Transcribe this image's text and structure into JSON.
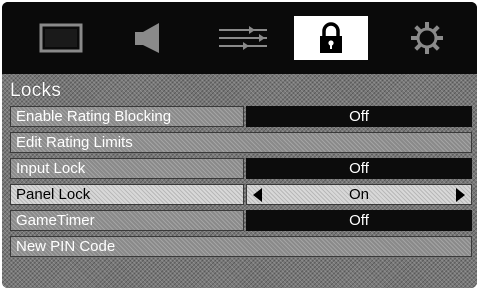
{
  "icons": {
    "picture": "picture-icon",
    "audio": "speaker-icon",
    "setup": "sliders-icon",
    "locks": "lock-icon",
    "settings": "gear-icon"
  },
  "menu": {
    "title": "Locks",
    "items": [
      {
        "label": "Enable Rating Blocking",
        "value": "Off"
      },
      {
        "label": "Edit Rating Limits"
      },
      {
        "label": "Input Lock",
        "value": "Off"
      },
      {
        "label": "Panel Lock",
        "value": "On"
      },
      {
        "label": "GameTimer",
        "value": "Off"
      },
      {
        "label": "New PIN Code"
      }
    ]
  }
}
